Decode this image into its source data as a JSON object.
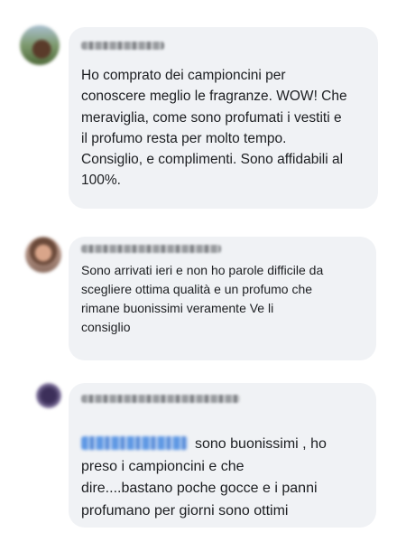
{
  "comments": [
    {
      "text": "Ho comprato dei campioncini per\nconoscere meglio le fragranze. WOW! Che\nmeraviglia, come sono profumati i vestiti e\nil profumo resta per molto tempo.\nConsiglio, e complimenti. Sono affidabili al\n100%."
    },
    {
      "text": "Sono arrivati ieri e non ho parole difficile da\nscegliere ottima qualità e un profumo che\nrimane buonissimi veramente Ve li\nconsiglio"
    },
    {
      "text": "sono buonissimi , ho\npreso i campioncini e che\ndire....bastano poche gocce e i panni\nprofumano per giorni sono ottimi"
    }
  ],
  "colors": {
    "bubble": "#f0f2f5",
    "text": "#1c1e21",
    "mention": "#3b82e0"
  }
}
